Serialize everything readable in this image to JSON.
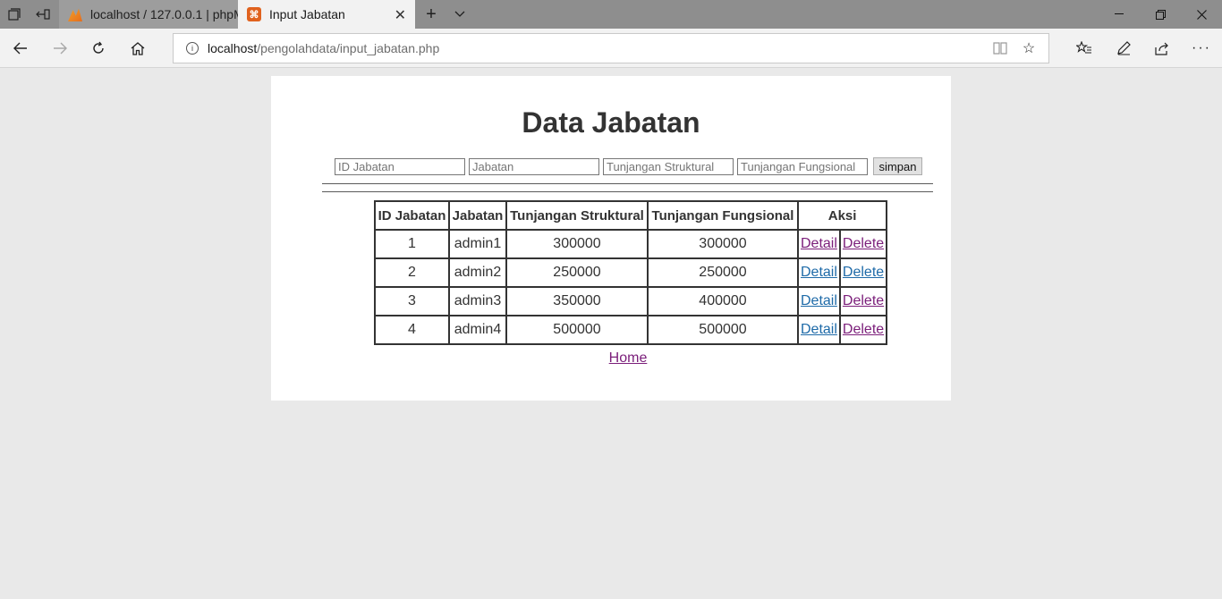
{
  "browser": {
    "tabs": [
      {
        "title": "localhost / 127.0.0.1 | phpM",
        "active": false,
        "favicon": "phpmyadmin-icon"
      },
      {
        "title": "Input Jabatan",
        "active": true,
        "favicon": "xampp-icon"
      }
    ],
    "address": {
      "host": "localhost",
      "path": "/pengolahdata/input_jabatan.php"
    }
  },
  "page": {
    "title": "Data Jabatan",
    "form": {
      "id_placeholder": "ID Jabatan",
      "jabatan_placeholder": "Jabatan",
      "struktural_placeholder": "Tunjangan Struktural",
      "fungsional_placeholder": "Tunjangan Fungsional",
      "submit_label": "simpan"
    },
    "table": {
      "headers": {
        "id": "ID Jabatan",
        "jabatan": "Jabatan",
        "struktural": "Tunjangan Struktural",
        "fungsional": "Tunjangan Fungsional",
        "aksi": "Aksi"
      },
      "rows": [
        {
          "id": "1",
          "jabatan": "admin1",
          "struktural": "300000",
          "fungsional": "300000",
          "detail": "Detail",
          "delete": "Delete"
        },
        {
          "id": "2",
          "jabatan": "admin2",
          "struktural": "250000",
          "fungsional": "250000",
          "detail": "Detail",
          "delete": "Delete"
        },
        {
          "id": "3",
          "jabatan": "admin3",
          "struktural": "350000",
          "fungsional": "400000",
          "detail": "Detail",
          "delete": "Delete"
        },
        {
          "id": "4",
          "jabatan": "admin4",
          "struktural": "500000",
          "fungsional": "500000",
          "detail": "Detail",
          "delete": "Delete"
        }
      ]
    },
    "home_link": "Home"
  },
  "colors": {
    "visited_link": "#7b1e7a",
    "unvisited_link": "#1e6aa8",
    "page_background": "#e9e9e9"
  }
}
